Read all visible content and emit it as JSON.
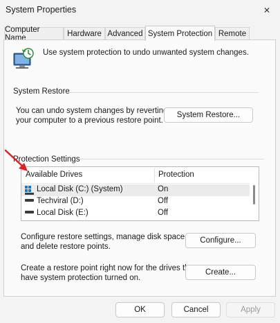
{
  "window": {
    "title": "System Properties",
    "close_glyph": "✕"
  },
  "tabs": [
    {
      "label": "Computer Name",
      "active": false
    },
    {
      "label": "Hardware",
      "active": false
    },
    {
      "label": "Advanced",
      "active": false
    },
    {
      "label": "System Protection",
      "active": true
    },
    {
      "label": "Remote",
      "active": false
    }
  ],
  "intro": {
    "icon": "computer-shield-icon",
    "text": "Use system protection to undo unwanted system changes."
  },
  "system_restore": {
    "group_label": "System Restore",
    "description_line1": "You can undo system changes by reverting",
    "description_line2": "your computer to a previous restore point.",
    "button_label": "System Restore..."
  },
  "protection": {
    "group_label": "Protection Settings",
    "columns": [
      "Available Drives",
      "Protection"
    ],
    "drives": [
      {
        "name": "Local Disk (C:) (System)",
        "protection": "On",
        "icon": "windows-drive-icon",
        "selected": true
      },
      {
        "name": "Techviral (D:)",
        "protection": "Off",
        "icon": "drive-icon",
        "selected": false
      },
      {
        "name": "Local Disk (E:)",
        "protection": "Off",
        "icon": "drive-icon",
        "selected": false
      }
    ],
    "configure_line1": "Configure restore settings, manage disk space,",
    "configure_line2": "and delete restore points.",
    "configure_button": "Configure...",
    "create_line1": "Create a restore point right now for the drives that",
    "create_line2": "have system protection turned on.",
    "create_button": "Create..."
  },
  "footer": {
    "ok": "OK",
    "cancel": "Cancel",
    "apply": "Apply"
  },
  "colors": {
    "annotation_arrow": "#e02020",
    "windows_logo": "#1a78c2"
  }
}
